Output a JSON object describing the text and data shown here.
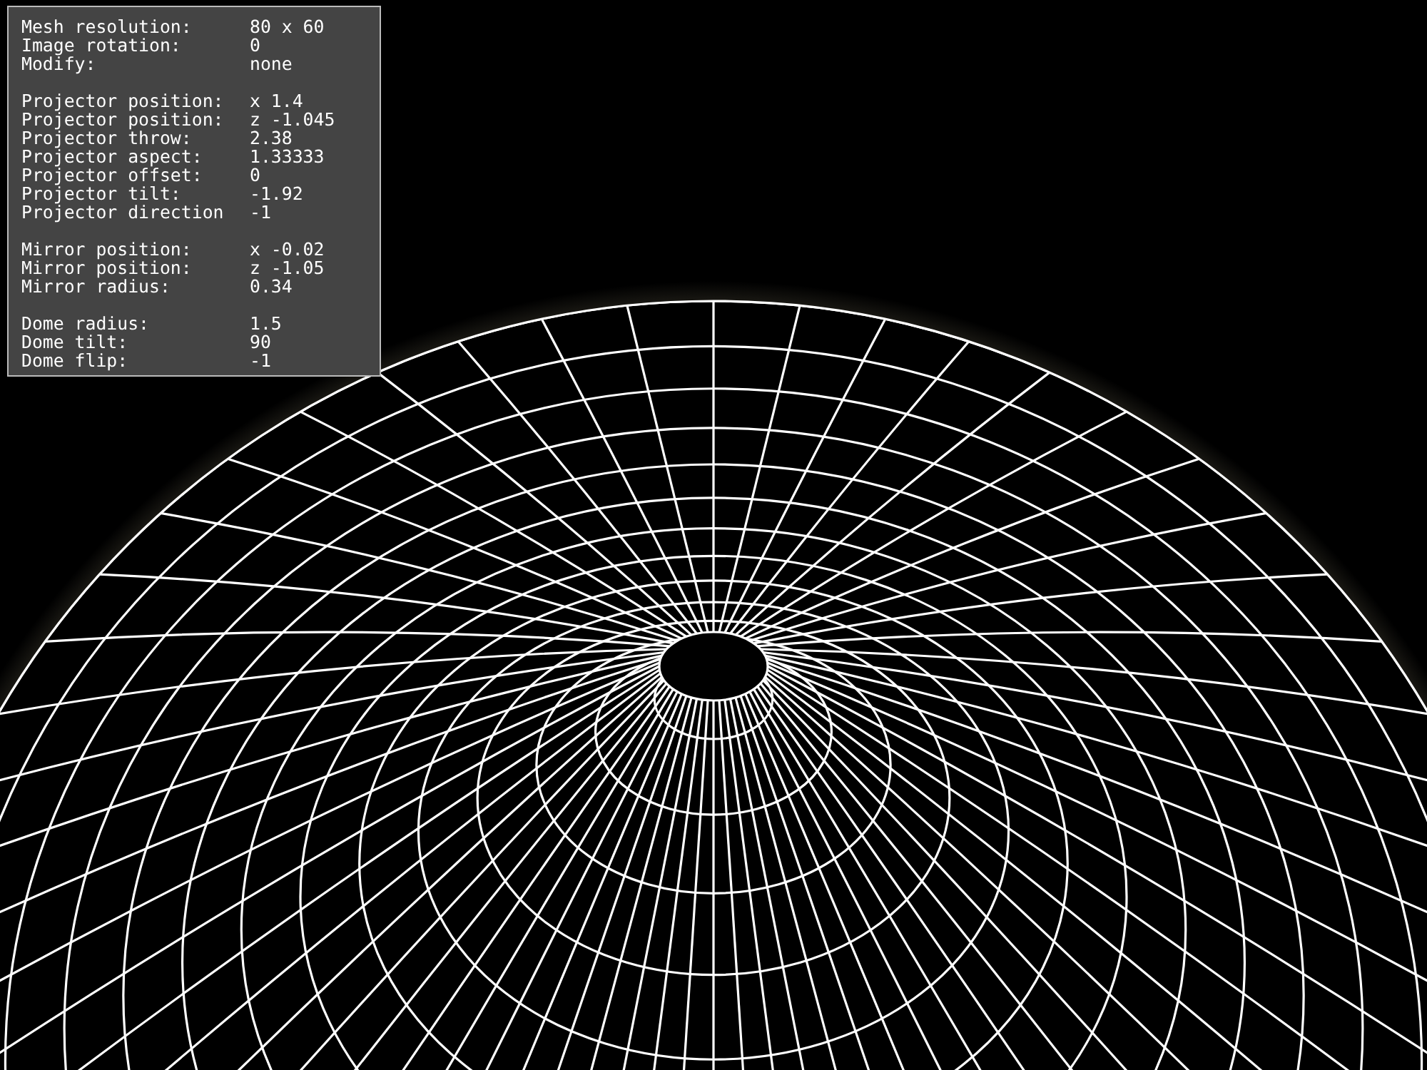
{
  "info_panel": {
    "groups": [
      {
        "rows": [
          {
            "label": "Mesh resolution:",
            "value": "80 x 60"
          },
          {
            "label": "Image rotation:",
            "value": "0"
          },
          {
            "label": "Modify:",
            "value": "none"
          }
        ]
      },
      {
        "rows": [
          {
            "label": "Projector position:",
            "value": "x 1.4"
          },
          {
            "label": "Projector position:",
            "value": "z -1.045"
          },
          {
            "label": "Projector throw:",
            "value": "2.38"
          },
          {
            "label": "Projector aspect:",
            "value": "1.33333"
          },
          {
            "label": "Projector offset:",
            "value": "0"
          },
          {
            "label": "Projector tilt:",
            "value": "-1.92"
          },
          {
            "label": "Projector direction",
            "value": "-1"
          }
        ]
      },
      {
        "rows": [
          {
            "label": "Mirror position:",
            "value": "x -0.02"
          },
          {
            "label": "Mirror position:",
            "value": "z -1.05"
          },
          {
            "label": "Mirror radius:",
            "value": "0.34"
          }
        ]
      },
      {
        "rows": [
          {
            "label": "Dome radius:",
            "value": "1.5"
          },
          {
            "label": "Dome tilt:",
            "value": "90"
          },
          {
            "label": "Dome flip:",
            "value": "-1"
          }
        ]
      }
    ]
  }
}
